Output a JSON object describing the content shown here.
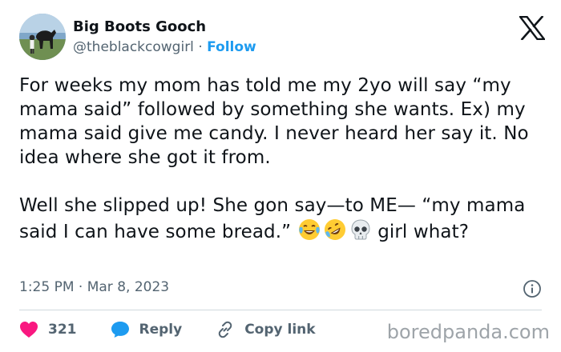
{
  "author": {
    "name": "Big Boots Gooch",
    "handle": "@theblackcowgirl",
    "separator": "·",
    "follow_label": "Follow",
    "avatar_icon": "avatar-photo-person-with-horse"
  },
  "platform": {
    "logo_icon": "x-logo-icon"
  },
  "tweet": {
    "text_part1": "For weeks my mom has told me my 2yo will say “my mama said” followed by something she wants. Ex) my mama said give me candy. I never heard her say it. No idea where she got it from.\n\nWell she slipped up! She gon say—to ME— “my mama said I can have some bread.”",
    "emojis": [
      "face-with-tears-of-joy",
      "rolling-on-the-floor-laughing",
      "skull"
    ],
    "text_part2": "girl what?"
  },
  "meta": {
    "time": "1:25 PM",
    "separator": "·",
    "date": "Mar 8, 2023",
    "info_icon": "info-icon"
  },
  "actions": {
    "like_count": "321",
    "reply_label": "Reply",
    "copy_label": "Copy link"
  },
  "watermark": "boredpanda.com",
  "colors": {
    "accent": "#1d9bf0",
    "like": "#f91880",
    "text": "#0f1419",
    "muted": "#536471",
    "divider": "#cfd9de"
  }
}
